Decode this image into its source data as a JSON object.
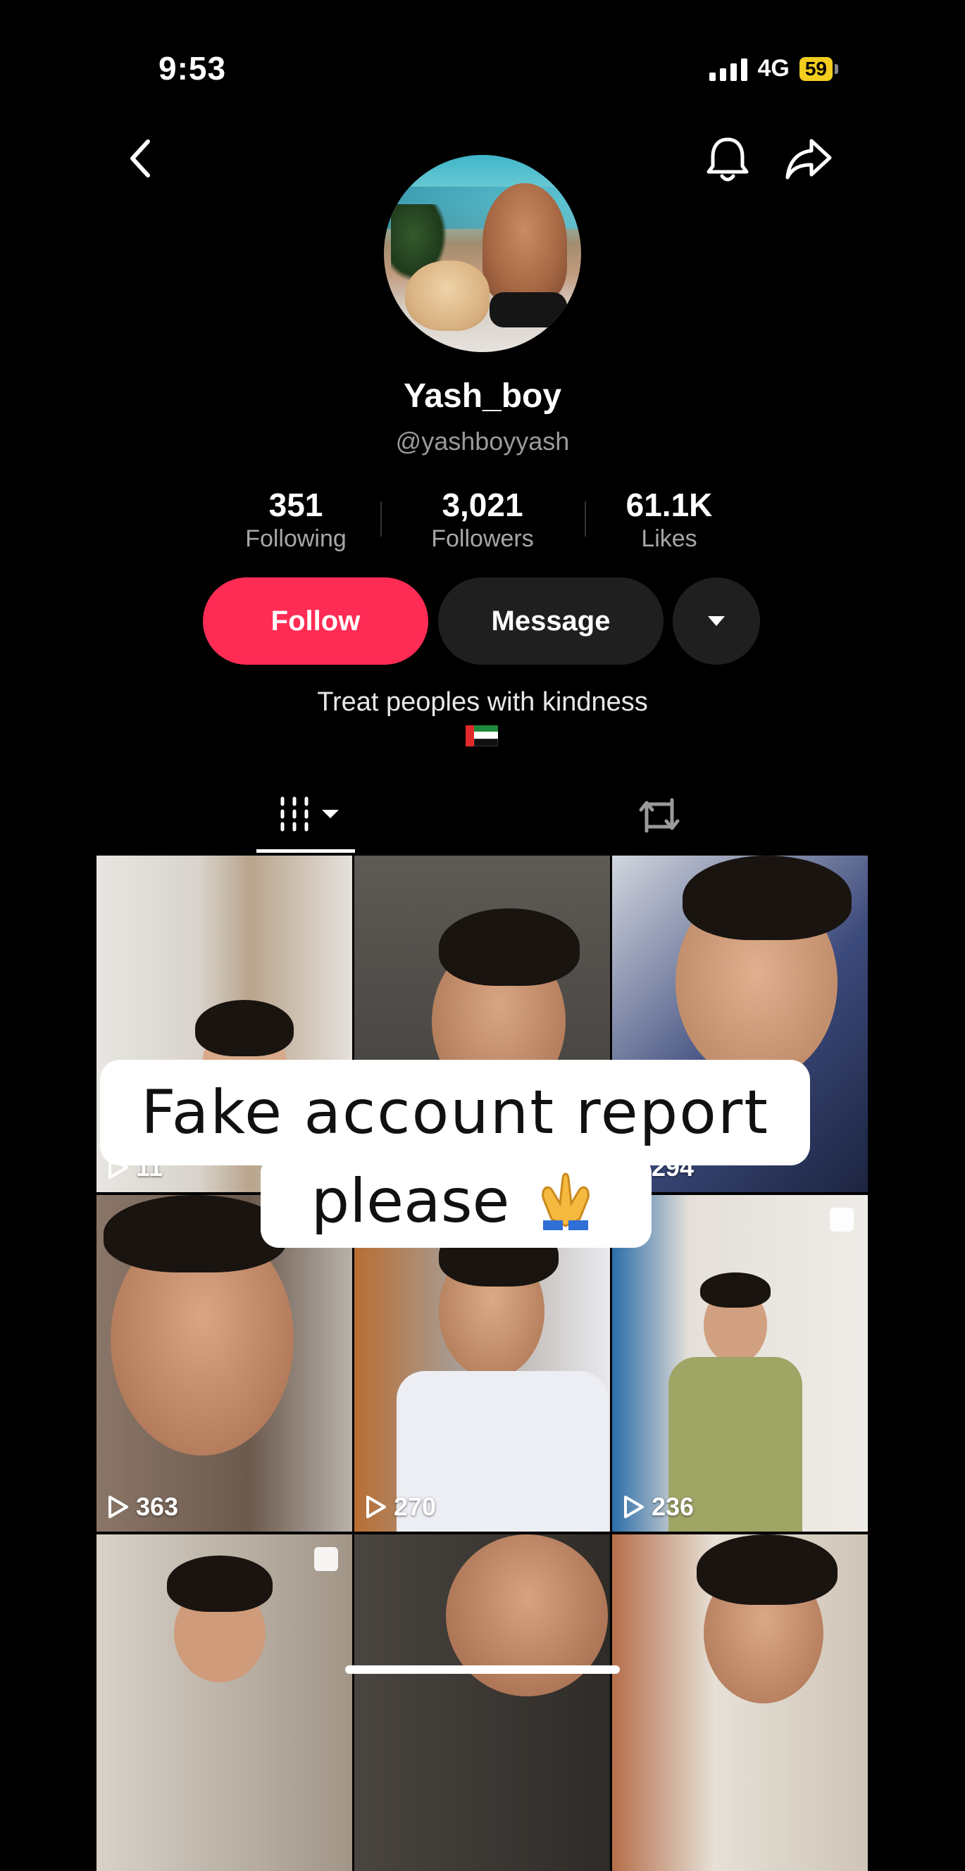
{
  "status_bar": {
    "time": "9:53",
    "network": "4G",
    "battery": "59"
  },
  "profile": {
    "display_name": "Yash_boy",
    "handle": "@yashboyyash",
    "stats": [
      {
        "value": "351",
        "label": "Following"
      },
      {
        "value": "3,021",
        "label": "Followers"
      },
      {
        "value": "61.1K",
        "label": "Likes"
      }
    ],
    "bio": "Treat peoples with kindness"
  },
  "actions": {
    "follow_label": "Follow",
    "message_label": "Message"
  },
  "accent_color": "#fe2c55",
  "tabs": {
    "videos_icon": "grid-columns-icon",
    "reposts_icon": "repost-icon"
  },
  "videos": [
    {
      "views": "11"
    },
    {
      "views": ""
    },
    {
      "views": "294"
    },
    {
      "views": "363"
    },
    {
      "views": "270"
    },
    {
      "views": "236"
    },
    {
      "views": ""
    },
    {
      "views": ""
    },
    {
      "views": ""
    }
  ],
  "overlay": {
    "line1": "Fake account report",
    "line2": "please"
  }
}
